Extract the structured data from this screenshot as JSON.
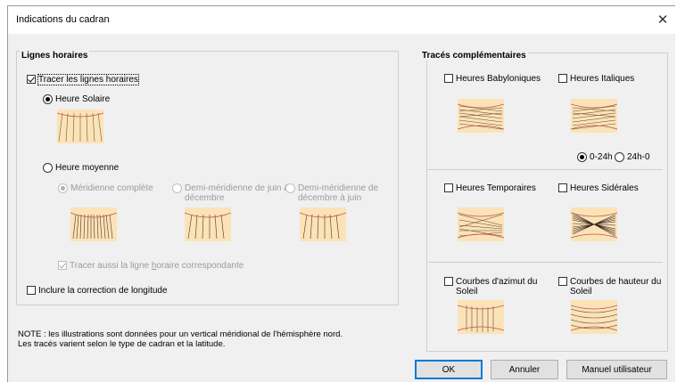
{
  "window": {
    "title": "Indications du cadran",
    "close_glyph": "✕"
  },
  "left": {
    "legend": "Lignes horaires",
    "tracer": "Tracer les lignes horaires",
    "heure_solaire": "Heure Solaire",
    "heure_moyenne": "Heure moyenne",
    "meridienne_complete": "Méridienne complète",
    "demi_juin_dec_1": "Demi-méridienne de juin à",
    "demi_juin_dec_2": "décembre",
    "demi_dec_juin_1": "Demi-méridienne de",
    "demi_dec_juin_2": "décembre à juin",
    "tracer_aussi_pre": "Tracer aussi la ligne ",
    "tracer_aussi_key": "h",
    "tracer_aussi_post": "oraire correspondante",
    "inclure": "Inclure la correction de longitude"
  },
  "right": {
    "legend": "Tracés complémentaires",
    "babyloniques": "Heures Babyloniques",
    "italiques": "Heures Italiques",
    "r0_24": "0-24h",
    "r24_0": "24h-0",
    "temporaires": "Heures Temporaires",
    "siderales": "Heures Sidérales",
    "azimut_1": "Courbes d'azimut du",
    "azimut_2": "Soleil",
    "hauteur_1": "Courbes de hauteur du",
    "hauteur_2": "Soleil"
  },
  "note": {
    "line1": "NOTE : les illustrations sont données pour un vertical méridional de l'hémisphère nord.",
    "line2": "Les tracés varient selon le type de cadran et la latitude."
  },
  "buttons": {
    "ok": "OK",
    "annuler": "Annuler",
    "manuel": "Manuel utilisateur"
  },
  "colors": {
    "thumb_bg": "#fbe3b8",
    "thumb_edge": "#e0a0a0",
    "accent": "#0078d7"
  }
}
